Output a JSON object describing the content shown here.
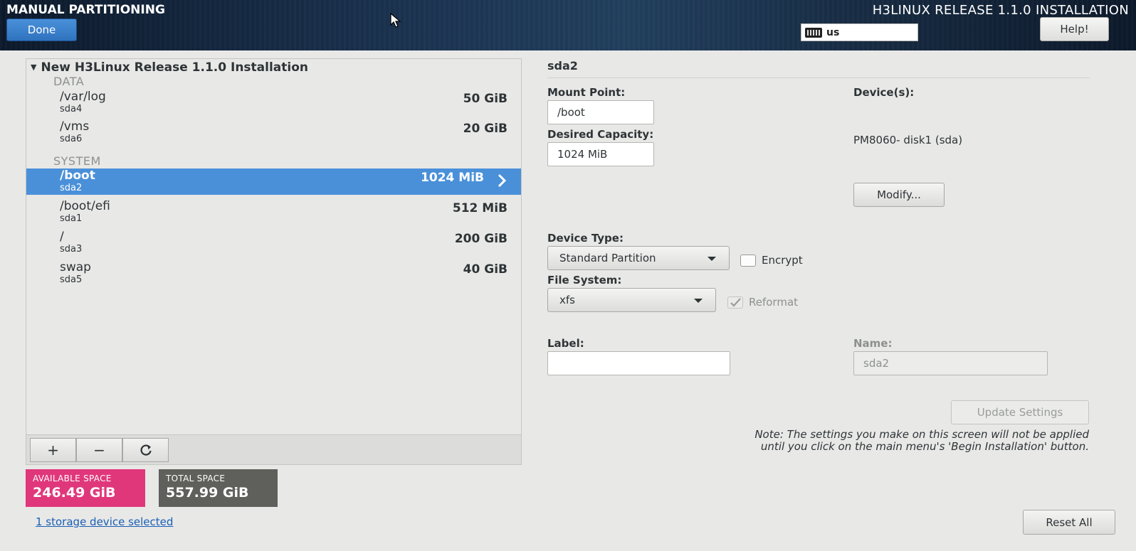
{
  "header": {
    "title": "MANUAL PARTITIONING",
    "done_label": "Done",
    "release": "H3LINUX RELEASE 1.1.0 INSTALLATION",
    "keyboard_layout": "us",
    "help_label": "Help!"
  },
  "tree": {
    "title": "New H3Linux Release 1.1.0 Installation",
    "groups": [
      {
        "label": "DATA",
        "items": [
          {
            "mount": "/var/log",
            "device": "sda4",
            "size": "50 GiB"
          },
          {
            "mount": "/vms",
            "device": "sda6",
            "size": "20 GiB"
          }
        ]
      },
      {
        "label": "SYSTEM",
        "items": [
          {
            "mount": "/boot",
            "device": "sda2",
            "size": "1024 MiB"
          },
          {
            "mount": "/boot/efi",
            "device": "sda1",
            "size": "512 MiB"
          },
          {
            "mount": "/",
            "device": "sda3",
            "size": "200 GiB"
          },
          {
            "mount": "swap",
            "device": "sda5",
            "size": "40 GiB"
          }
        ]
      }
    ],
    "toolbar": {
      "add": "+",
      "remove": "−",
      "refresh": "⟳"
    }
  },
  "space": {
    "available_label": "AVAILABLE SPACE",
    "available_value": "246.49 GiB",
    "total_label": "TOTAL SPACE",
    "total_value": "557.99 GiB"
  },
  "storage_link": "1 storage device selected",
  "details": {
    "title": "sda2",
    "mount_point_label": "Mount Point:",
    "mount_point_value": "/boot",
    "capacity_label": "Desired Capacity:",
    "capacity_value": "1024 MiB",
    "devices_label": "Device(s):",
    "device_name": "PM8060- disk1 (sda)",
    "modify_label": "Modify...",
    "device_type_label": "Device Type:",
    "device_type_value": "Standard Partition",
    "encrypt_label": "Encrypt",
    "file_system_label": "File System:",
    "file_system_value": "xfs",
    "reformat_label": "Reformat",
    "label_label": "Label:",
    "label_value": "",
    "name_label": "Name:",
    "name_value": "sda2",
    "update_label": "Update Settings",
    "note": "Note:  The settings you make on this screen will not be applied until you click on the main menu's 'Begin Installation' button.",
    "reset_label": "Reset All"
  },
  "colors": {
    "accent": "#4a90d9",
    "available": "#e0377b",
    "total": "#5f605b"
  }
}
